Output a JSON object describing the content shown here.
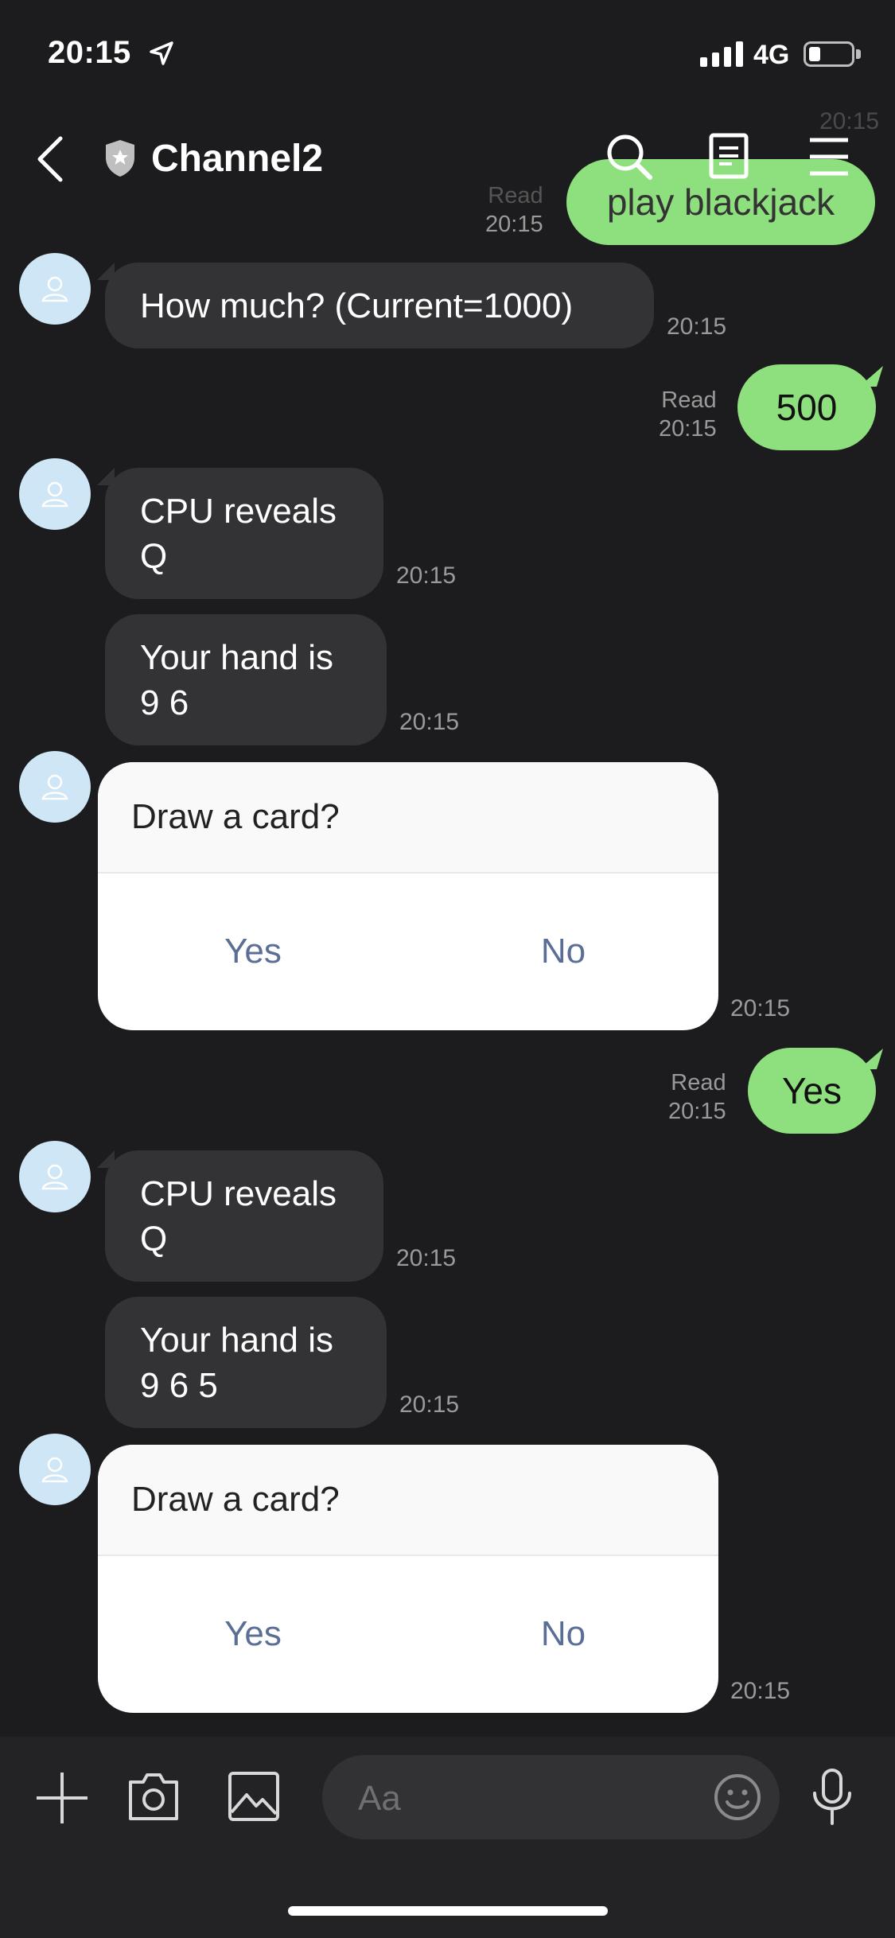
{
  "status": {
    "time": "20:15",
    "network": "4G"
  },
  "header": {
    "title": "Channel2"
  },
  "messages": {
    "m0": {
      "text": "play blackjack",
      "read": "Read",
      "time": "20:15",
      "ts_top": "20:15"
    },
    "m1": {
      "text": "How much? (Current=1000)",
      "time": "20:15"
    },
    "m2": {
      "text": "500",
      "read": "Read",
      "time": "20:15"
    },
    "m3": {
      "line1": "CPU reveals",
      "line2": "Q",
      "time": "20:15"
    },
    "m4": {
      "line1": "Your hand is",
      "line2": "9 6",
      "time": "20:15"
    },
    "m5": {
      "question": "Draw a card?",
      "yes": "Yes",
      "no": "No",
      "time": "20:15"
    },
    "m6": {
      "text": "Yes",
      "read": "Read",
      "time": "20:15"
    },
    "m7": {
      "line1": "CPU reveals",
      "line2": "Q",
      "time": "20:15"
    },
    "m8": {
      "line1": "Your hand is",
      "line2": "9 6 5",
      "time": "20:15"
    },
    "m9": {
      "question": "Draw a card?",
      "yes": "Yes",
      "no": "No",
      "time": "20:15"
    }
  },
  "composer": {
    "placeholder": "Aa"
  },
  "colors": {
    "bubble_out": "#8ee07e",
    "bubble_in": "#333335",
    "background": "#1c1c1e",
    "option_text": "#5b6f96"
  }
}
